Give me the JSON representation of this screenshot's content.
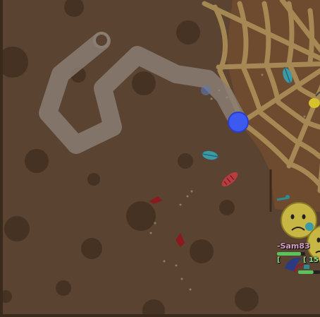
{
  "players": [
    {
      "name": "-Sam83",
      "level": "[",
      "health": 0.85
    },
    {
      "name": "",
      "level": "[ 15",
      "health": 0.7
    }
  ],
  "colors": {
    "ground": "#5a4330",
    "spot": "#3e2c1e",
    "web": "#a88c55",
    "trail": "#8a7d72",
    "player_body": "#c7b544",
    "player_orb": "#3d5af0",
    "health_fill": "#5cc25c"
  }
}
